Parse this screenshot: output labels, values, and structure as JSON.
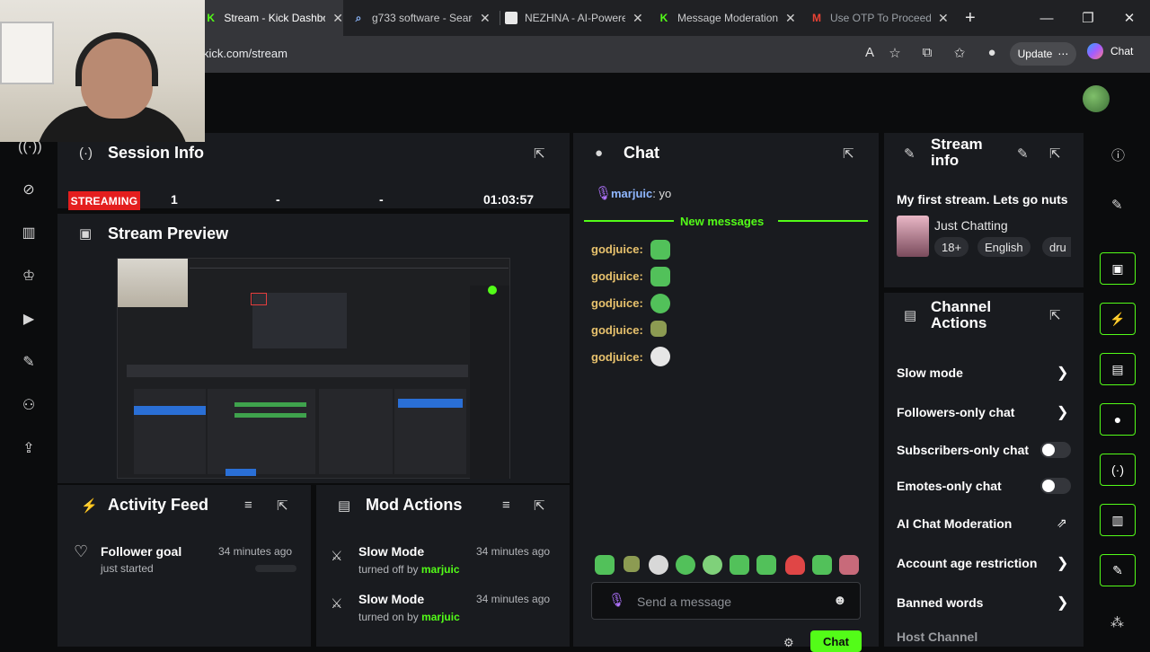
{
  "browser": {
    "tabs": [
      {
        "title": "Stream - Kick Dashbo",
        "icon": "kick-icon"
      },
      {
        "title": "g733 software - Searc",
        "icon": "search-icon"
      },
      {
        "title": "NEZHNA - AI-Powere",
        "icon": "nezhna-icon"
      },
      {
        "title": "Message Moderation",
        "icon": "kick-icon"
      },
      {
        "title": "Use OTP To Proceed",
        "icon": "gmail-icon"
      }
    ],
    "url": "kick.com/stream",
    "update_label": "Update",
    "copilot_label": "Chat"
  },
  "session_info": {
    "title": "Session Info",
    "status": "STREAMING",
    "viewers": "1",
    "stat2": "-",
    "stat3": "-",
    "uptime": "01:03:57"
  },
  "stream_preview": {
    "title": "Stream Preview"
  },
  "chat": {
    "title": "Chat",
    "first_message": {
      "user": "marjuic",
      "text": ": yo"
    },
    "new_messages_label": "New messages",
    "messages": [
      {
        "user": "godjuice",
        "sep": ":"
      },
      {
        "user": "godjuice",
        "sep": ":"
      },
      {
        "user": "godjuice",
        "sep": ":"
      },
      {
        "user": "godjuice",
        "sep": ":"
      },
      {
        "user": "godjuice",
        "sep": ":"
      }
    ],
    "input_placeholder": "Send a message",
    "send_label": "Chat"
  },
  "stream_info": {
    "title_line1": "Stream",
    "title_line2": "info",
    "stream_title": "My first stream. Lets go nuts",
    "category": "Just Chatting",
    "tags": [
      "18+",
      "English",
      "dru"
    ]
  },
  "channel_actions": {
    "title_line1": "Channel",
    "title_line2": "Actions",
    "items": [
      {
        "label": "Slow mode",
        "control": "chevron"
      },
      {
        "label": "Followers-only chat",
        "control": "chevron"
      },
      {
        "label": "Subscribers-only chat",
        "control": "toggle"
      },
      {
        "label": "Emotes-only chat",
        "control": "toggle"
      },
      {
        "label": "AI Chat Moderation",
        "control": "external"
      },
      {
        "label": "Account age restriction",
        "control": "chevron"
      },
      {
        "label": "Banned words",
        "control": "chevron"
      },
      {
        "label": "Host Channel",
        "control": "none"
      }
    ]
  },
  "activity_feed": {
    "title": "Activity Feed",
    "items": [
      {
        "title": "Follower goal",
        "sub": "just started",
        "time": "34 minutes ago"
      }
    ]
  },
  "mod_actions": {
    "title": "Mod Actions",
    "items": [
      {
        "title": "Slow Mode",
        "sub": "turned off by ",
        "user": "marjuic",
        "time": "34 minutes ago"
      },
      {
        "title": "Slow Mode",
        "sub": "turned on by ",
        "user": "marjuic",
        "time": "34 minutes ago"
      }
    ]
  },
  "colors": {
    "accent": "#53fc18",
    "streaming": "#e41e1e",
    "panel": "#191b1f",
    "username": "#e8c26d"
  }
}
